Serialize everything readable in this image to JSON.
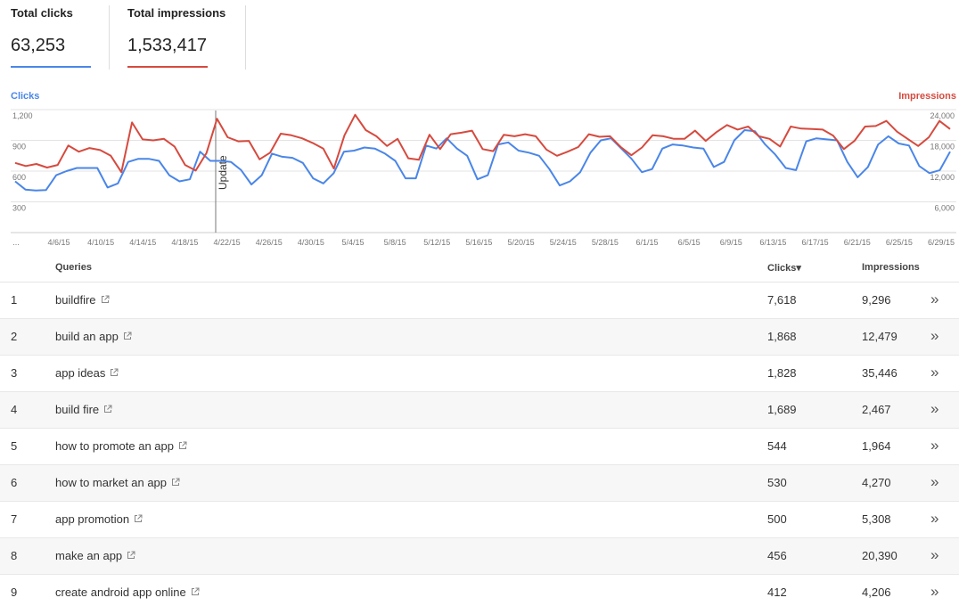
{
  "metrics": {
    "clicks": {
      "label": "Total clicks",
      "value": "63,253",
      "color": "#4a86e8"
    },
    "impressions": {
      "label": "Total impressions",
      "value": "1,533,417",
      "color": "#d64a3e"
    }
  },
  "chart_data": {
    "type": "line",
    "left_axis_label": "Clicks",
    "right_axis_label": "Impressions",
    "left_ticks": [
      "1,200",
      "900",
      "600",
      "300"
    ],
    "right_ticks": [
      "24,000",
      "18,000",
      "12,000",
      "6,000"
    ],
    "left_ylim": [
      0,
      1200
    ],
    "right_ylim": [
      0,
      24000
    ],
    "grid": true,
    "x_labels": [
      "...",
      "4/6/15",
      "4/10/15",
      "4/14/15",
      "4/18/15",
      "4/22/15",
      "4/26/15",
      "4/30/15",
      "5/4/15",
      "5/8/15",
      "5/12/15",
      "5/16/15",
      "5/20/15",
      "5/24/15",
      "5/28/15",
      "6/1/15",
      "6/5/15",
      "6/9/15",
      "6/13/15",
      "6/17/15",
      "6/21/15",
      "6/25/15",
      "6/29/15"
    ],
    "annotation": "Update",
    "series": [
      {
        "name": "Clicks",
        "axis": "left",
        "color": "#4a86e8",
        "values": [
          500,
          420,
          410,
          415,
          560,
          600,
          630,
          630,
          630,
          440,
          480,
          690,
          720,
          720,
          700,
          560,
          500,
          520,
          790,
          700,
          700,
          690,
          610,
          470,
          560,
          770,
          740,
          730,
          680,
          530,
          480,
          580,
          790,
          800,
          830,
          820,
          770,
          700,
          530,
          530,
          850,
          820,
          920,
          820,
          750,
          520,
          560,
          860,
          880,
          800,
          780,
          750,
          620,
          460,
          500,
          590,
          780,
          900,
          920,
          820,
          720,
          590,
          620,
          820,
          860,
          850,
          830,
          820,
          640,
          690,
          900,
          1000,
          990,
          860,
          760,
          630,
          610,
          890,
          920,
          910,
          900,
          690,
          540,
          640,
          860,
          940,
          870,
          850,
          650,
          580,
          610,
          790
        ]
      },
      {
        "name": "Impressions",
        "axis": "right",
        "color": "#d64a3e",
        "values": [
          13600,
          13000,
          13400,
          12700,
          13200,
          17000,
          15800,
          16500,
          16100,
          15000,
          11800,
          21500,
          18200,
          18000,
          18300,
          16800,
          13200,
          12100,
          15500,
          22200,
          18600,
          17800,
          17900,
          14300,
          15600,
          19300,
          19000,
          18400,
          17500,
          16400,
          12500,
          19000,
          23000,
          20000,
          18800,
          16900,
          18300,
          14500,
          14200,
          19100,
          16300,
          19200,
          19500,
          19900,
          16300,
          15900,
          19100,
          18800,
          19200,
          18800,
          16200,
          15000,
          15800,
          16700,
          19200,
          18700,
          18800,
          16700,
          15100,
          16600,
          19000,
          18800,
          18300,
          18300,
          19900,
          17900,
          19600,
          21000,
          20100,
          20700,
          18800,
          18300,
          16800,
          20700,
          20300,
          20200,
          20100,
          18900,
          16300,
          17900,
          20700,
          20800,
          21800,
          19700,
          18300,
          16900,
          18600,
          21800,
          20200
        ]
      }
    ]
  },
  "table": {
    "headers": {
      "queries": "Queries",
      "clicks": "Clicks▾",
      "impressions": "Impressions"
    },
    "rows": [
      {
        "idx": "1",
        "query": "buildfire",
        "clicks": "7,618",
        "impressions": "9,296"
      },
      {
        "idx": "2",
        "query": "build an app",
        "clicks": "1,868",
        "impressions": "12,479"
      },
      {
        "idx": "3",
        "query": "app ideas",
        "clicks": "1,828",
        "impressions": "35,446"
      },
      {
        "idx": "4",
        "query": "build fire",
        "clicks": "1,689",
        "impressions": "2,467"
      },
      {
        "idx": "5",
        "query": "how to promote an app",
        "clicks": "544",
        "impressions": "1,964"
      },
      {
        "idx": "6",
        "query": "how to market an app",
        "clicks": "530",
        "impressions": "4,270"
      },
      {
        "idx": "7",
        "query": "app promotion",
        "clicks": "500",
        "impressions": "5,308"
      },
      {
        "idx": "8",
        "query": "make an app",
        "clicks": "456",
        "impressions": "20,390"
      },
      {
        "idx": "9",
        "query": "create android app online",
        "clicks": "412",
        "impressions": "4,206"
      }
    ],
    "row_action_glyph": "»",
    "link_icon": "external-link-icon"
  }
}
